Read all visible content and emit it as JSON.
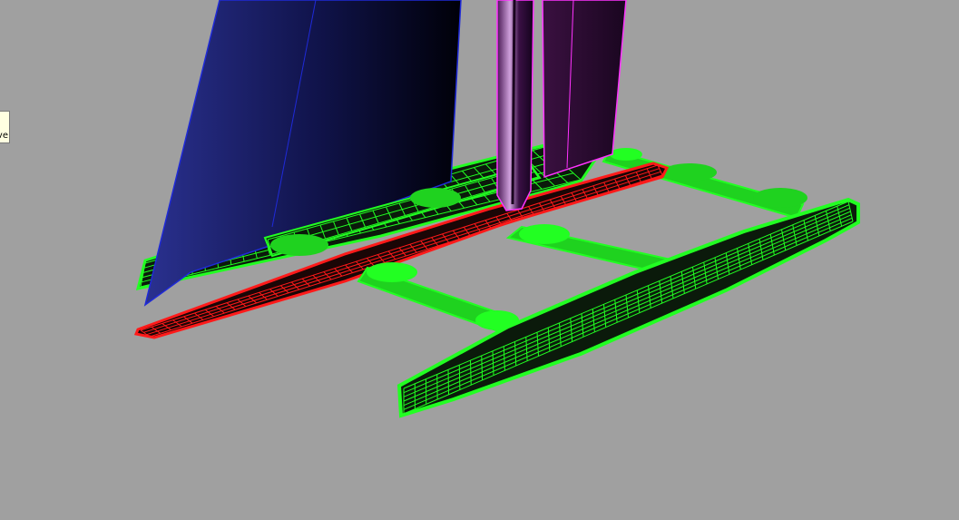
{
  "viewport": {
    "name": "3d-perspective-viewport",
    "background": "#a0a0a0",
    "display_mode": "wireframe-shaded"
  },
  "tooltip": {
    "text": "ve"
  },
  "colors": {
    "hull_mesh": "#22ff22",
    "center_hull_mesh": "#ff1a1a",
    "hull_fill": "#0b1a0b",
    "jib_edge": "#1f2ad8",
    "jib_fill_light": "#242a8a",
    "jib_fill_dark": "#000010",
    "mast_edge": "#ff33ff",
    "mast_fill": "#2a0a2e"
  },
  "objects": [
    {
      "name": "jib-sail",
      "type": "surface"
    },
    {
      "name": "main-wing-sail",
      "type": "surface"
    },
    {
      "name": "mast",
      "type": "surface"
    },
    {
      "name": "center-hull",
      "type": "wireframe-mesh"
    },
    {
      "name": "port-hull",
      "type": "wireframe-mesh"
    },
    {
      "name": "starboard-hull",
      "type": "wireframe-mesh"
    },
    {
      "name": "front-beam",
      "type": "wireframe-mesh"
    },
    {
      "name": "rear-beam",
      "type": "wireframe-mesh"
    }
  ]
}
